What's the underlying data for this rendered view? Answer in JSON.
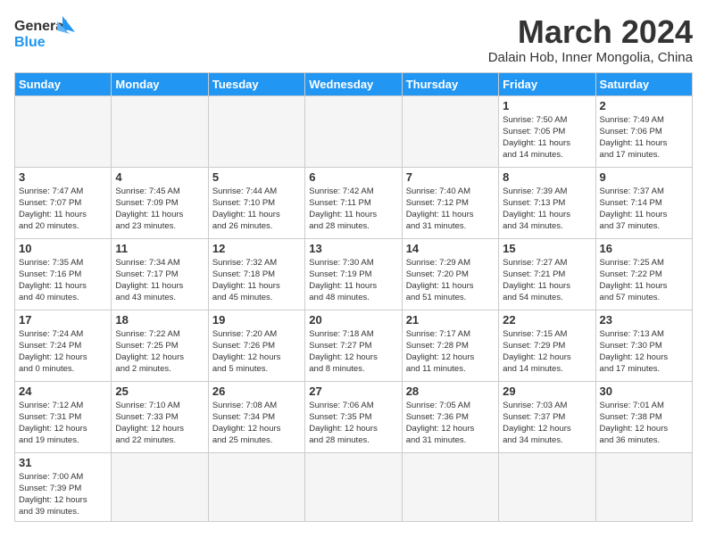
{
  "header": {
    "logo_general": "General",
    "logo_blue": "Blue",
    "title": "March 2024",
    "subtitle": "Dalain Hob, Inner Mongolia, China"
  },
  "days_of_week": [
    "Sunday",
    "Monday",
    "Tuesday",
    "Wednesday",
    "Thursday",
    "Friday",
    "Saturday"
  ],
  "weeks": [
    [
      {
        "day": "",
        "info": ""
      },
      {
        "day": "",
        "info": ""
      },
      {
        "day": "",
        "info": ""
      },
      {
        "day": "",
        "info": ""
      },
      {
        "day": "",
        "info": ""
      },
      {
        "day": "1",
        "info": "Sunrise: 7:50 AM\nSunset: 7:05 PM\nDaylight: 11 hours\nand 14 minutes."
      },
      {
        "day": "2",
        "info": "Sunrise: 7:49 AM\nSunset: 7:06 PM\nDaylight: 11 hours\nand 17 minutes."
      }
    ],
    [
      {
        "day": "3",
        "info": "Sunrise: 7:47 AM\nSunset: 7:07 PM\nDaylight: 11 hours\nand 20 minutes."
      },
      {
        "day": "4",
        "info": "Sunrise: 7:45 AM\nSunset: 7:09 PM\nDaylight: 11 hours\nand 23 minutes."
      },
      {
        "day": "5",
        "info": "Sunrise: 7:44 AM\nSunset: 7:10 PM\nDaylight: 11 hours\nand 26 minutes."
      },
      {
        "day": "6",
        "info": "Sunrise: 7:42 AM\nSunset: 7:11 PM\nDaylight: 11 hours\nand 28 minutes."
      },
      {
        "day": "7",
        "info": "Sunrise: 7:40 AM\nSunset: 7:12 PM\nDaylight: 11 hours\nand 31 minutes."
      },
      {
        "day": "8",
        "info": "Sunrise: 7:39 AM\nSunset: 7:13 PM\nDaylight: 11 hours\nand 34 minutes."
      },
      {
        "day": "9",
        "info": "Sunrise: 7:37 AM\nSunset: 7:14 PM\nDaylight: 11 hours\nand 37 minutes."
      }
    ],
    [
      {
        "day": "10",
        "info": "Sunrise: 7:35 AM\nSunset: 7:16 PM\nDaylight: 11 hours\nand 40 minutes."
      },
      {
        "day": "11",
        "info": "Sunrise: 7:34 AM\nSunset: 7:17 PM\nDaylight: 11 hours\nand 43 minutes."
      },
      {
        "day": "12",
        "info": "Sunrise: 7:32 AM\nSunset: 7:18 PM\nDaylight: 11 hours\nand 45 minutes."
      },
      {
        "day": "13",
        "info": "Sunrise: 7:30 AM\nSunset: 7:19 PM\nDaylight: 11 hours\nand 48 minutes."
      },
      {
        "day": "14",
        "info": "Sunrise: 7:29 AM\nSunset: 7:20 PM\nDaylight: 11 hours\nand 51 minutes."
      },
      {
        "day": "15",
        "info": "Sunrise: 7:27 AM\nSunset: 7:21 PM\nDaylight: 11 hours\nand 54 minutes."
      },
      {
        "day": "16",
        "info": "Sunrise: 7:25 AM\nSunset: 7:22 PM\nDaylight: 11 hours\nand 57 minutes."
      }
    ],
    [
      {
        "day": "17",
        "info": "Sunrise: 7:24 AM\nSunset: 7:24 PM\nDaylight: 12 hours\nand 0 minutes."
      },
      {
        "day": "18",
        "info": "Sunrise: 7:22 AM\nSunset: 7:25 PM\nDaylight: 12 hours\nand 2 minutes."
      },
      {
        "day": "19",
        "info": "Sunrise: 7:20 AM\nSunset: 7:26 PM\nDaylight: 12 hours\nand 5 minutes."
      },
      {
        "day": "20",
        "info": "Sunrise: 7:18 AM\nSunset: 7:27 PM\nDaylight: 12 hours\nand 8 minutes."
      },
      {
        "day": "21",
        "info": "Sunrise: 7:17 AM\nSunset: 7:28 PM\nDaylight: 12 hours\nand 11 minutes."
      },
      {
        "day": "22",
        "info": "Sunrise: 7:15 AM\nSunset: 7:29 PM\nDaylight: 12 hours\nand 14 minutes."
      },
      {
        "day": "23",
        "info": "Sunrise: 7:13 AM\nSunset: 7:30 PM\nDaylight: 12 hours\nand 17 minutes."
      }
    ],
    [
      {
        "day": "24",
        "info": "Sunrise: 7:12 AM\nSunset: 7:31 PM\nDaylight: 12 hours\nand 19 minutes."
      },
      {
        "day": "25",
        "info": "Sunrise: 7:10 AM\nSunset: 7:33 PM\nDaylight: 12 hours\nand 22 minutes."
      },
      {
        "day": "26",
        "info": "Sunrise: 7:08 AM\nSunset: 7:34 PM\nDaylight: 12 hours\nand 25 minutes."
      },
      {
        "day": "27",
        "info": "Sunrise: 7:06 AM\nSunset: 7:35 PM\nDaylight: 12 hours\nand 28 minutes."
      },
      {
        "day": "28",
        "info": "Sunrise: 7:05 AM\nSunset: 7:36 PM\nDaylight: 12 hours\nand 31 minutes."
      },
      {
        "day": "29",
        "info": "Sunrise: 7:03 AM\nSunset: 7:37 PM\nDaylight: 12 hours\nand 34 minutes."
      },
      {
        "day": "30",
        "info": "Sunrise: 7:01 AM\nSunset: 7:38 PM\nDaylight: 12 hours\nand 36 minutes."
      }
    ],
    [
      {
        "day": "31",
        "info": "Sunrise: 7:00 AM\nSunset: 7:39 PM\nDaylight: 12 hours\nand 39 minutes."
      },
      {
        "day": "",
        "info": ""
      },
      {
        "day": "",
        "info": ""
      },
      {
        "day": "",
        "info": ""
      },
      {
        "day": "",
        "info": ""
      },
      {
        "day": "",
        "info": ""
      },
      {
        "day": "",
        "info": ""
      }
    ]
  ]
}
